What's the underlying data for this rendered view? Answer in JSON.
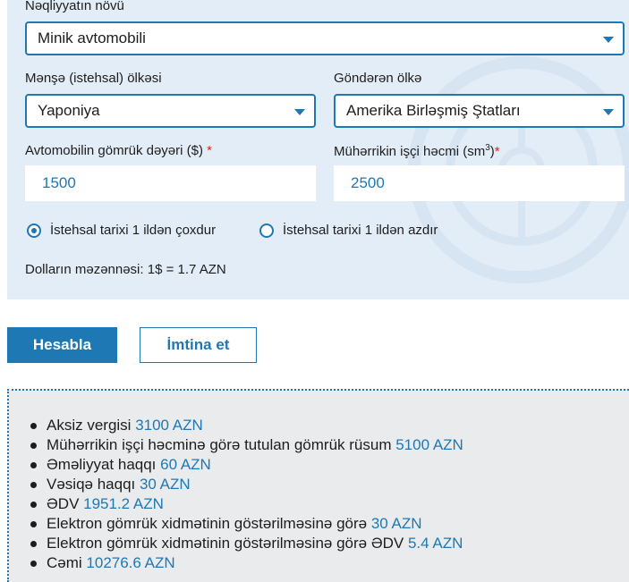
{
  "form": {
    "vehicle_type_label": "Nəqliyyatın növü",
    "vehicle_type_value": "Minik avtomobili",
    "origin_label": "Mənşə (istehsal) ölkəsi",
    "origin_value": "Yaponiya",
    "sender_label": "Göndərən ölkə",
    "sender_value": "Amerika Birləşmiş Ştatları",
    "customs_value_label": "Avtomobilin gömrük dəyəri ($)",
    "customs_value": "1500",
    "engine_label": "Mühərrikin işçi həcmi (sm",
    "engine_unit_sup": "3",
    "engine_label_end": ")",
    "engine_value": "2500",
    "required_mark": "*",
    "radio_over_1_year": "İstehsal tarixi 1 ildən çoxdur",
    "radio_under_1_year": "İstehsal tarixi 1 ildən azdır",
    "exchange_rate": "Dolların məzənnəsi: 1$ = 1.7 AZN"
  },
  "buttons": {
    "calculate": "Hesabla",
    "cancel": "İmtina et"
  },
  "results": [
    {
      "label": "Aksiz vergisi ",
      "value": "3100 AZN"
    },
    {
      "label": "Mühərrikin işçi həcminə görə tutulan gömrük rüsum ",
      "value": "5100 AZN"
    },
    {
      "label": "Əməliyyat haqqı ",
      "value": "60 AZN"
    },
    {
      "label": "Vəsiqə haqqı ",
      "value": "30 AZN"
    },
    {
      "label": "ƏDV ",
      "value": "1951.2 AZN"
    },
    {
      "label": "Elektron gömrük xidmətinin göstərilməsinə görə ",
      "value": "30 AZN"
    },
    {
      "label": "Elektron gömrük xidmətinin göstərilməsinə görə ƏDV ",
      "value": "5.4 AZN"
    },
    {
      "label": "Cəmi ",
      "value": "10276.6 AZN"
    }
  ],
  "colors": {
    "accent": "#1e78b4",
    "panel_bg": "#e3edf7",
    "results_bg": "#e9ebed",
    "required": "#e2231a"
  }
}
